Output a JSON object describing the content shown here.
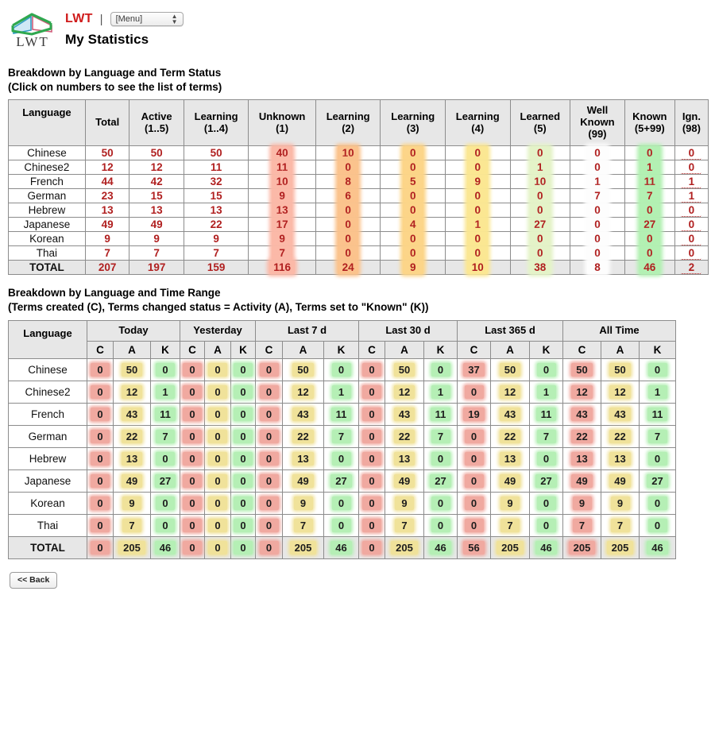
{
  "header": {
    "logo_text": "LWT",
    "brand": "LWT",
    "separator": "|",
    "menu_value": "[Menu]",
    "page_title": "My Statistics"
  },
  "section1": {
    "caption_line1": "Breakdown by Language and Term Status",
    "caption_line2": "(Click on numbers to see the list of terms)",
    "columns": [
      "Language",
      "Total",
      "Active (1..5)",
      "Learning (1..4)",
      "Unknown (1)",
      "Learning (2)",
      "Learning (3)",
      "Learning (4)",
      "Learned (5)",
      "Well Known (99)",
      "Known (5+99)",
      "Ign. (98)"
    ],
    "columns_split": [
      {
        "l1": "Language",
        "l2": ""
      },
      {
        "l1": "Total",
        "l2": ""
      },
      {
        "l1": "Active",
        "l2": "(1..5)"
      },
      {
        "l1": "Learning",
        "l2": "(1..4)"
      },
      {
        "l1": "Unknown",
        "l2": "(1)"
      },
      {
        "l1": "Learning",
        "l2": "(2)"
      },
      {
        "l1": "Learning",
        "l2": "(3)"
      },
      {
        "l1": "Learning",
        "l2": "(4)"
      },
      {
        "l1": "Learned",
        "l2": "(5)"
      },
      {
        "l1": "Well Known",
        "l2": "(99)"
      },
      {
        "l1": "Known",
        "l2": "(5+99)"
      },
      {
        "l1": "Ign.",
        "l2": "(98)"
      }
    ],
    "rows": [
      {
        "language": "Chinese",
        "values": [
          "50",
          "50",
          "50",
          "40",
          "10",
          "0",
          "0",
          "0",
          "0",
          "0",
          "0"
        ]
      },
      {
        "language": "Chinese2",
        "values": [
          "12",
          "12",
          "11",
          "11",
          "0",
          "0",
          "0",
          "1",
          "0",
          "1",
          "0"
        ]
      },
      {
        "language": "French",
        "values": [
          "44",
          "42",
          "32",
          "10",
          "8",
          "5",
          "9",
          "10",
          "1",
          "11",
          "1"
        ]
      },
      {
        "language": "German",
        "values": [
          "23",
          "15",
          "15",
          "9",
          "6",
          "0",
          "0",
          "0",
          "7",
          "7",
          "1"
        ]
      },
      {
        "language": "Hebrew",
        "values": [
          "13",
          "13",
          "13",
          "13",
          "0",
          "0",
          "0",
          "0",
          "0",
          "0",
          "0"
        ]
      },
      {
        "language": "Japanese",
        "values": [
          "49",
          "49",
          "22",
          "17",
          "0",
          "4",
          "1",
          "27",
          "0",
          "27",
          "0"
        ]
      },
      {
        "language": "Korean",
        "values": [
          "9",
          "9",
          "9",
          "9",
          "0",
          "0",
          "0",
          "0",
          "0",
          "0",
          "0"
        ]
      },
      {
        "language": "Thai",
        "values": [
          "7",
          "7",
          "7",
          "7",
          "0",
          "0",
          "0",
          "0",
          "0",
          "0",
          "0"
        ]
      }
    ],
    "total_row": {
      "language": "TOTAL",
      "values": [
        "207",
        "197",
        "159",
        "116",
        "24",
        "9",
        "10",
        "38",
        "8",
        "46",
        "2"
      ]
    }
  },
  "section2": {
    "caption_line1": "Breakdown by Language and Time Range",
    "caption_line2": "(Terms created (C), Terms changed status = Activity (A), Terms set to \"Known\" (K))",
    "lang_header": "Language",
    "period_groups": [
      "Today",
      "Yesterday",
      "Last 7 d",
      "Last 30 d",
      "Last 365 d",
      "All Time"
    ],
    "sub_columns": [
      "C",
      "A",
      "K"
    ],
    "rows": [
      {
        "language": "Chinese",
        "values": [
          "0",
          "50",
          "0",
          "0",
          "0",
          "0",
          "0",
          "50",
          "0",
          "0",
          "50",
          "0",
          "37",
          "50",
          "0",
          "50",
          "50",
          "0"
        ]
      },
      {
        "language": "Chinese2",
        "values": [
          "0",
          "12",
          "1",
          "0",
          "0",
          "0",
          "0",
          "12",
          "1",
          "0",
          "12",
          "1",
          "0",
          "12",
          "1",
          "12",
          "12",
          "1"
        ]
      },
      {
        "language": "French",
        "values": [
          "0",
          "43",
          "11",
          "0",
          "0",
          "0",
          "0",
          "43",
          "11",
          "0",
          "43",
          "11",
          "19",
          "43",
          "11",
          "43",
          "43",
          "11"
        ]
      },
      {
        "language": "German",
        "values": [
          "0",
          "22",
          "7",
          "0",
          "0",
          "0",
          "0",
          "22",
          "7",
          "0",
          "22",
          "7",
          "0",
          "22",
          "7",
          "22",
          "22",
          "7"
        ]
      },
      {
        "language": "Hebrew",
        "values": [
          "0",
          "13",
          "0",
          "0",
          "0",
          "0",
          "0",
          "13",
          "0",
          "0",
          "13",
          "0",
          "0",
          "13",
          "0",
          "13",
          "13",
          "0"
        ]
      },
      {
        "language": "Japanese",
        "values": [
          "0",
          "49",
          "27",
          "0",
          "0",
          "0",
          "0",
          "49",
          "27",
          "0",
          "49",
          "27",
          "0",
          "49",
          "27",
          "49",
          "49",
          "27"
        ]
      },
      {
        "language": "Korean",
        "values": [
          "0",
          "9",
          "0",
          "0",
          "0",
          "0",
          "0",
          "9",
          "0",
          "0",
          "9",
          "0",
          "0",
          "9",
          "0",
          "9",
          "9",
          "0"
        ]
      },
      {
        "language": "Thai",
        "values": [
          "0",
          "7",
          "0",
          "0",
          "0",
          "0",
          "0",
          "7",
          "0",
          "0",
          "7",
          "0",
          "0",
          "7",
          "0",
          "7",
          "7",
          "0"
        ]
      }
    ],
    "total_row": {
      "language": "TOTAL",
      "values": [
        "0",
        "205",
        "46",
        "0",
        "0",
        "0",
        "0",
        "205",
        "46",
        "0",
        "205",
        "46",
        "56",
        "205",
        "46",
        "205",
        "205",
        "46"
      ]
    }
  },
  "footer": {
    "back_label": "<< Back"
  },
  "colors": {
    "brand_red": "#cf1a1a",
    "number_red": "#b01f1f",
    "unknown_bg": "#fbb9a8",
    "learning2_bg": "#fbc38d",
    "learning3_bg": "#fcd589",
    "learning4_bg": "#fbe793",
    "learned_bg": "#e4f3c8",
    "known_bg": "#b3f0b3",
    "created_bg": "#f0a9a0",
    "activity_bg": "#f0e29a",
    "known2_bg": "#b5efb5",
    "header_bg": "#e7e7e7"
  }
}
